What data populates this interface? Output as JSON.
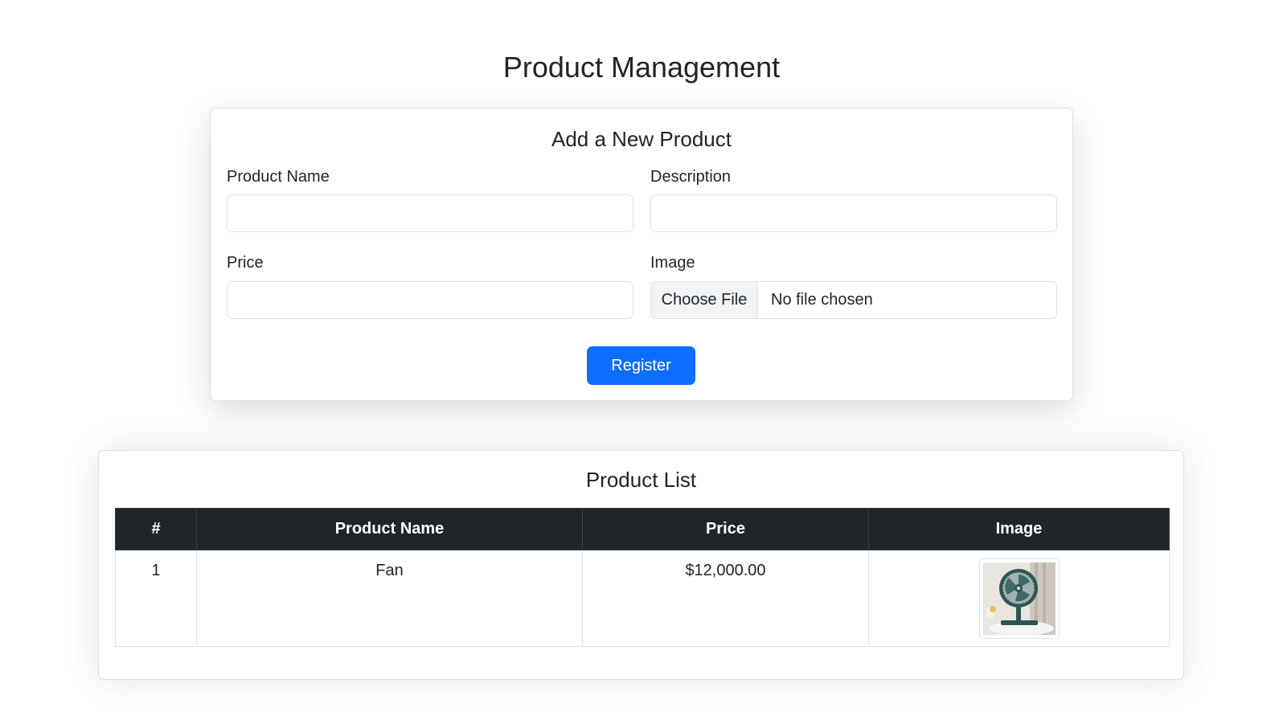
{
  "page": {
    "title": "Product Management"
  },
  "form": {
    "title": "Add a New Product",
    "product_name_label": "Product Name",
    "product_name_value": "",
    "description_label": "Description",
    "description_value": "",
    "price_label": "Price",
    "price_value": "",
    "image_label": "Image",
    "file_button_label": "Choose File",
    "file_status": "No file chosen",
    "register_label": "Register"
  },
  "product_list": {
    "title": "Product List",
    "columns": [
      "#",
      "Product Name",
      "Price",
      "Image"
    ],
    "rows": [
      {
        "index": "1",
        "name": "Fan",
        "price": "$12,000.00",
        "image_icon": "fan-image"
      }
    ]
  },
  "colors": {
    "primary": "#0d6efd",
    "table_header_bg": "#212529",
    "text": "#212529"
  }
}
